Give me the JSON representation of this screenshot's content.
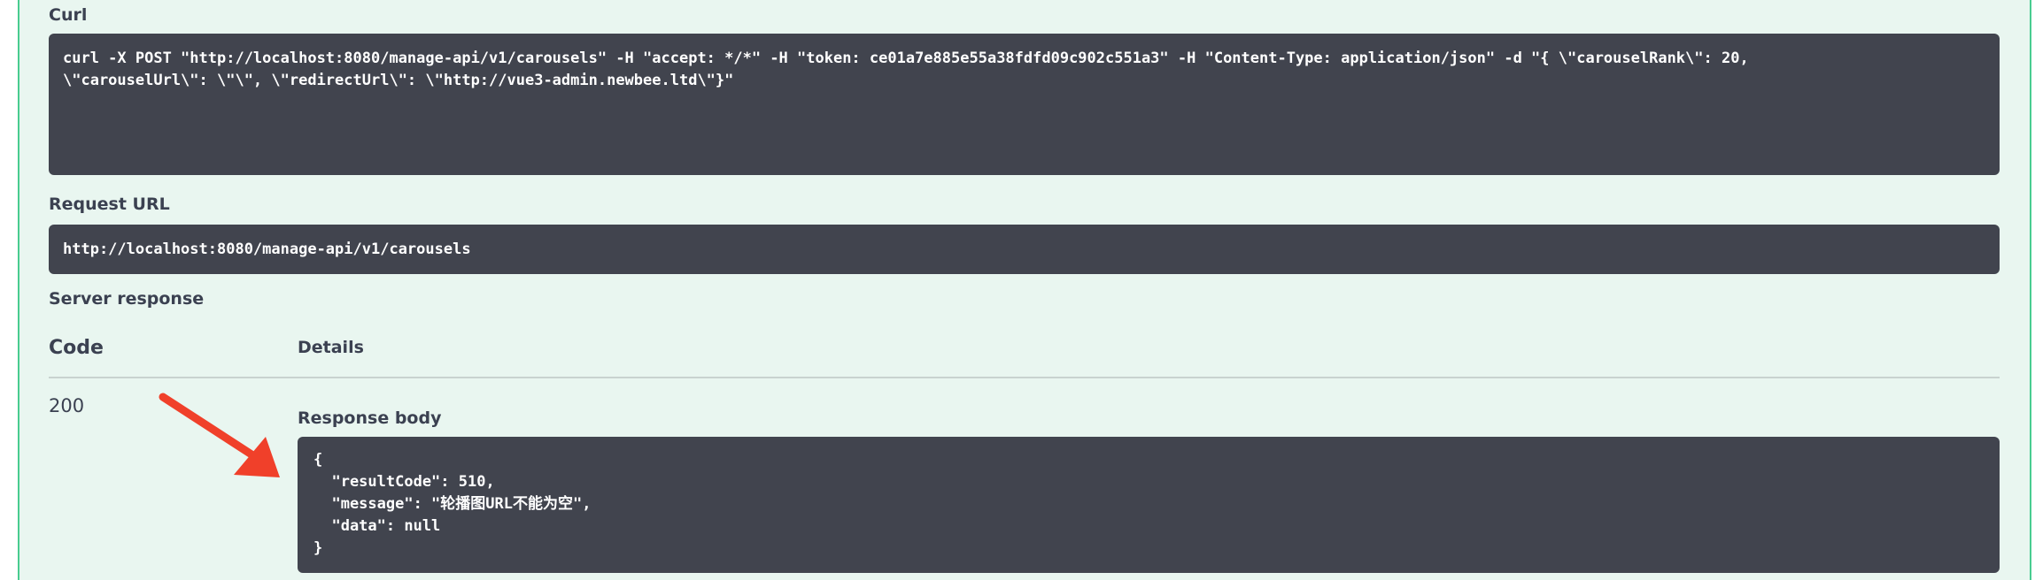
{
  "curl": {
    "label": "Curl",
    "line1": "curl -X POST \"http://localhost:8080/manage-api/v1/carousels\" -H \"accept: */*\" -H \"token: ce01a7e885e55a38fdfd09c902c551a3\" -H \"Content-Type: application/json\" -d \"{ \\\"carouselRank\\\": 20,",
    "line2": "\\\"carouselUrl\\\": \\\"\\\", \\\"redirectUrl\\\": \\\"http://vue3-admin.newbee.ltd\\\"}\""
  },
  "request_url": {
    "label": "Request URL",
    "value": "http://localhost:8080/manage-api/v1/carousels"
  },
  "server_response": {
    "label": "Server response",
    "code_header": "Code",
    "details_header": "Details",
    "code": "200",
    "response_body_label": "Response body",
    "body_lines": [
      "{",
      "  \"resultCode\": 510,",
      "  \"message\": \"轮播图URL不能为空\",",
      "  \"data\": null",
      "}"
    ]
  },
  "colors": {
    "panel_bg": "#e9f6f0",
    "panel_border": "#49cc90",
    "code_bg": "#41444e",
    "arrow": "#f0402a",
    "text": "#3b4151"
  },
  "icons": {
    "annotation": "red-arrow-icon"
  }
}
